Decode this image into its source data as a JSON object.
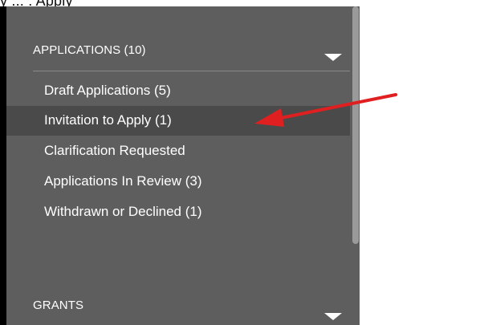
{
  "caption": {
    "text": "y     ...          .   Apply"
  },
  "sidebar": {
    "applications_section": {
      "title": "APPLICATIONS (10)",
      "caret_icon": "chevron-down-icon",
      "items": [
        {
          "label": "Draft Applications  (5)"
        },
        {
          "label": "Invitation to Apply  (1)",
          "active": true
        },
        {
          "label": "Clarification Requested"
        },
        {
          "label": "Applications In Review  (3)"
        },
        {
          "label": "Withdrawn or Declined  (1)"
        }
      ]
    },
    "grants_section": {
      "title": "GRANTS",
      "caret_icon": "chevron-down-icon"
    }
  },
  "annotation": {
    "arrow_color": "#e02020",
    "arrow_icon": "red-arrow-icon"
  },
  "colors": {
    "panel": "#5e5e5e",
    "active_row": "#4a4a4a",
    "text": "#ffffff",
    "scrollbar_thumb": "#9a9a9a"
  }
}
